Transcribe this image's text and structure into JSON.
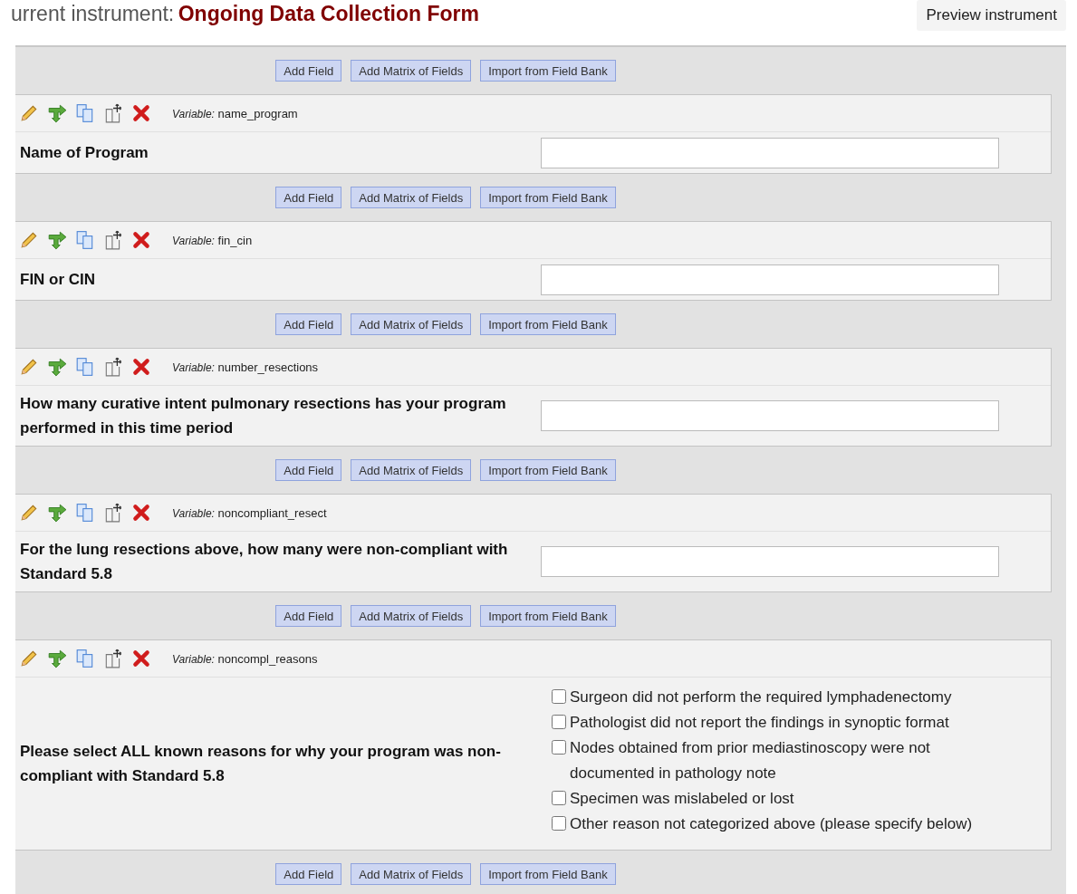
{
  "header": {
    "prefix": "urrent instrument:",
    "title": "Ongoing Data Collection Form",
    "preview_button": "Preview instrument"
  },
  "toolbars": [
    {
      "buttons": [
        "Add Field",
        "Add Matrix of Fields",
        "Import from Field Bank"
      ]
    },
    {
      "buttons": [
        "Add Field",
        "Add Matrix of Fields",
        "Import from Field Bank"
      ]
    },
    {
      "buttons": [
        "Add Field",
        "Add Matrix of Fields",
        "Import from Field Bank"
      ]
    },
    {
      "buttons": [
        "Add Field",
        "Add Matrix of Fields",
        "Import from Field Bank"
      ]
    },
    {
      "buttons": [
        "Add Field",
        "Add Matrix of Fields",
        "Import from Field Bank"
      ]
    },
    {
      "buttons": [
        "Add Field",
        "Add Matrix of Fields",
        "Import from Field Bank"
      ]
    }
  ],
  "fields": [
    {
      "variable_label": "Variable:",
      "variable": "name_program",
      "label": "Name of Program",
      "kind": "text"
    },
    {
      "variable_label": "Variable:",
      "variable": "fin_cin",
      "label": "FIN or CIN",
      "kind": "text"
    },
    {
      "variable_label": "Variable:",
      "variable": "number_resections",
      "label": "How many curative intent pulmonary resections has your program performed in this time period",
      "kind": "text"
    },
    {
      "variable_label": "Variable:",
      "variable": "noncompliant_resect",
      "label": "For the lung resections above, how many were non-compliant with Standard 5.8",
      "kind": "text"
    },
    {
      "variable_label": "Variable:",
      "variable": "noncompl_reasons",
      "label": "Please select ALL known reasons for why your program was non-compliant with Standard 5.8",
      "kind": "checkbox",
      "options": [
        {
          "label": "Surgeon did not perform the required lymphadenectomy",
          "checked": false
        },
        {
          "label": "Pathologist did not report the findings in synoptic format",
          "checked": false
        },
        {
          "label": "Nodes obtained from prior mediastinoscopy were not documented in pathology note",
          "checked": false
        },
        {
          "label": "Specimen was mislabeled or lost",
          "checked": false
        },
        {
          "label": "Other reason not categorized above (please specify below)",
          "checked": false
        }
      ]
    }
  ]
}
